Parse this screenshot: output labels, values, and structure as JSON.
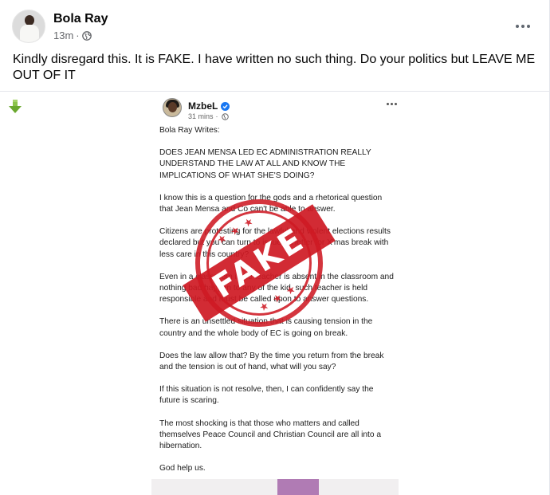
{
  "post": {
    "author": "Bola Ray",
    "time": "13m",
    "separator": "·",
    "visibility_icon": "globe-icon",
    "menu_icon": "more-horizontal-icon",
    "text": "Kindly disregard this. It is FAKE. I have written no such thing. Do your politics but LEAVE ME OUT OF IT"
  },
  "side_icon": "green-down-arrow-icon",
  "embedded": {
    "author": "MzbeL",
    "verified_icon": "verified-badge-icon",
    "time": "31 mins",
    "separator": "·",
    "paragraphs": [
      "Bola Ray Writes:",
      "DOES JEAN MENSA LED EC ADMINISTRATION REALLY UNDERSTAND THE LAW AT ALL AND KNOW THE IMPLICATIONS OF WHAT SHE'S DOING?",
      "I know this is a question for the gods and a rhetorical question that Jean Mensa and Co can't be able to answer.",
      "Citizens are protesting for the lawful and violent elections results declared but you can turn to issued a letter for X'mas break with less care in this country?",
      "Even in a classroom if the teacher is absent in the classroom and nothing bad happen to any of the kid, such teacher is held responsible and must be called upon to answer questions.",
      "There is an unsettled situation that is causing tension in the country and the whole body of EC is going on break.",
      "Does the law allow that? By the time you return from the break and the tension is out of hand, what will you say?",
      "If this situation is not resolve, then, I can confidently say the future is scaring.",
      "The most shocking is that those who matters and called themselves Peace Council and Christian Council are all into a hibernation.",
      "God help us."
    ],
    "stamp_text": "FAKE",
    "stamp_stars": "★★★",
    "stamp_color": "#ce1923"
  }
}
